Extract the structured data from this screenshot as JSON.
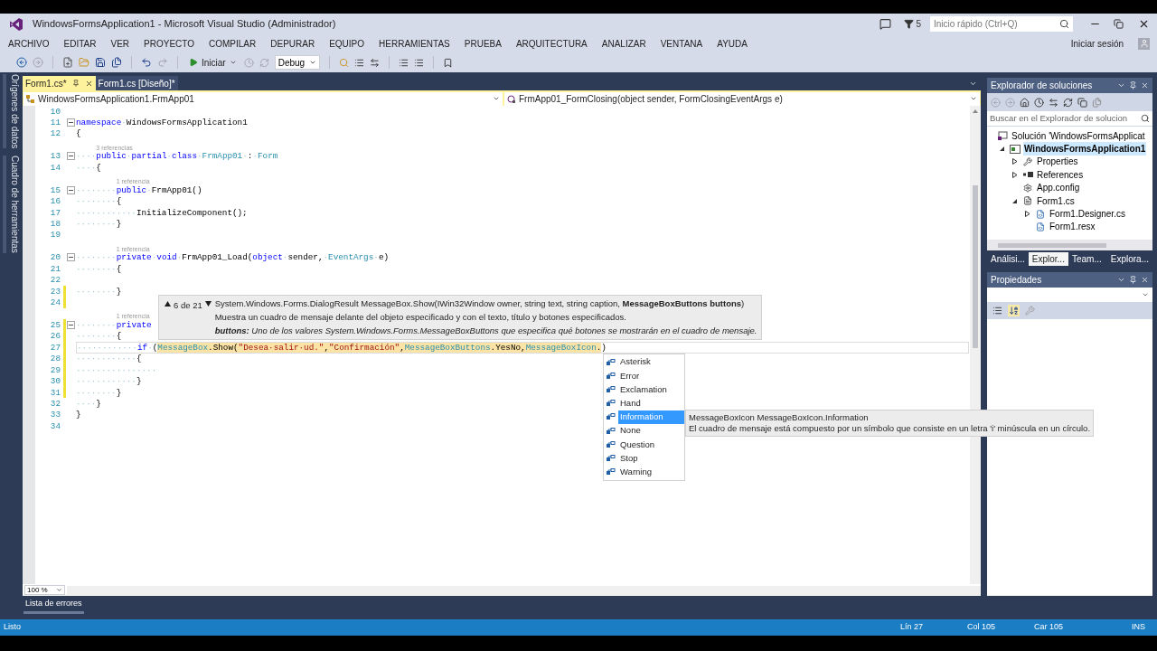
{
  "window": {
    "title": "WindowsFormsApplication1 - Microsoft Visual Studio (Administrador)",
    "notifications": "5",
    "quick_launch": {
      "placeholder": "Inicio rápido (Ctrl+Q)"
    },
    "sign_in": "Iniciar sesión"
  },
  "menu": [
    "ARCHIVO",
    "EDITAR",
    "VER",
    "PROYECTO",
    "COMPILAR",
    "DEPURAR",
    "EQUIPO",
    "HERRAMIENTAS",
    "PRUEBA",
    "ARQUITECTURA",
    "ANALIZAR",
    "VENTANA",
    "AYUDA"
  ],
  "toolbar": {
    "start": "Iniciar",
    "configuration": "Debug"
  },
  "side_tabs": [
    "Orígenes de datos",
    "Cuadro de herramientas"
  ],
  "document_tabs": [
    {
      "label": "Form1.cs*",
      "selected": true
    },
    {
      "label": "Form1.cs [Diseño]*",
      "selected": false
    }
  ],
  "navigation": {
    "type": "WindowsFormsApplication1.FrmApp01",
    "member": "FrmApp01_FormClosing(object sender, FormClosingEventArgs e)"
  },
  "editor": {
    "zoom": "100 %",
    "lines": [
      {
        "kind": "code",
        "number": "10",
        "fold": false,
        "changed": false,
        "current": false
      },
      {
        "kind": "code",
        "number": "11",
        "fold": true,
        "changed": false,
        "current": false,
        "tokens": [
          {
            "kind": "keyword",
            "text": "namespace"
          },
          {
            "kind": "space",
            "text": "·"
          },
          {
            "kind": "plain",
            "text": "WindowsFormsApplication1"
          }
        ]
      },
      {
        "kind": "code",
        "number": "12",
        "fold": false,
        "changed": false,
        "current": false,
        "tokens": [
          {
            "kind": "plain",
            "text": "{"
          }
        ]
      },
      {
        "kind": "codelens",
        "text": "3 referencias"
      },
      {
        "kind": "code",
        "number": "13",
        "fold": true,
        "changed": false,
        "current": false,
        "tokens": [
          {
            "kind": "space",
            "text": "····"
          },
          {
            "kind": "keyword",
            "text": "public"
          },
          {
            "kind": "space",
            "text": "·"
          },
          {
            "kind": "keyword",
            "text": "partial"
          },
          {
            "kind": "space",
            "text": "·"
          },
          {
            "kind": "keyword",
            "text": "class"
          },
          {
            "kind": "space",
            "text": "·"
          },
          {
            "kind": "type",
            "text": "FrmApp01"
          },
          {
            "kind": "space",
            "text": "·"
          },
          {
            "kind": "plain",
            "text": ":"
          },
          {
            "kind": "space",
            "text": "·"
          },
          {
            "kind": "type",
            "text": "Form"
          }
        ]
      },
      {
        "kind": "code",
        "number": "14",
        "fold": false,
        "changed": false,
        "current": false,
        "tokens": [
          {
            "kind": "space",
            "text": "····"
          },
          {
            "kind": "plain",
            "text": "{"
          }
        ]
      },
      {
        "kind": "codelens",
        "text": "1 referencia"
      },
      {
        "kind": "code",
        "number": "15",
        "fold": true,
        "changed": false,
        "current": false,
        "tokens": [
          {
            "kind": "space",
            "text": "········"
          },
          {
            "kind": "keyword",
            "text": "public"
          },
          {
            "kind": "space",
            "text": "·"
          },
          {
            "kind": "plain",
            "text": "FrmApp01()"
          }
        ]
      },
      {
        "kind": "code",
        "number": "16",
        "fold": false,
        "changed": false,
        "current": false,
        "tokens": [
          {
            "kind": "space",
            "text": "········"
          },
          {
            "kind": "plain",
            "text": "{"
          }
        ]
      },
      {
        "kind": "code",
        "number": "17",
        "fold": false,
        "changed": false,
        "current": false,
        "tokens": [
          {
            "kind": "space",
            "text": "············"
          },
          {
            "kind": "plain",
            "text": "InitializeComponent();"
          }
        ]
      },
      {
        "kind": "code",
        "number": "18",
        "fold": false,
        "changed": false,
        "current": false,
        "tokens": [
          {
            "kind": "space",
            "text": "········"
          },
          {
            "kind": "plain",
            "text": "}"
          }
        ]
      },
      {
        "kind": "code",
        "number": "19",
        "fold": false,
        "changed": false,
        "current": false
      },
      {
        "kind": "codelens",
        "text": "1 referencia"
      },
      {
        "kind": "code",
        "number": "20",
        "fold": true,
        "changed": false,
        "current": false,
        "tokens": [
          {
            "kind": "space",
            "text": "········"
          },
          {
            "kind": "keyword",
            "text": "private"
          },
          {
            "kind": "space",
            "text": "·"
          },
          {
            "kind": "keyword",
            "text": "void"
          },
          {
            "kind": "space",
            "text": "·"
          },
          {
            "kind": "plain",
            "text": "FrmApp01_Load("
          },
          {
            "kind": "keyword",
            "text": "object"
          },
          {
            "kind": "space",
            "text": "·"
          },
          {
            "kind": "plain",
            "text": "sender,"
          },
          {
            "kind": "space",
            "text": "·"
          },
          {
            "kind": "type",
            "text": "EventArgs"
          },
          {
            "kind": "space",
            "text": "·"
          },
          {
            "kind": "plain",
            "text": "e)"
          }
        ]
      },
      {
        "kind": "code",
        "number": "21",
        "fold": false,
        "changed": false,
        "current": false,
        "tokens": [
          {
            "kind": "space",
            "text": "········"
          },
          {
            "kind": "plain",
            "text": "{"
          }
        ]
      },
      {
        "kind": "code",
        "number": "22",
        "fold": false,
        "changed": false,
        "current": false
      },
      {
        "kind": "code",
        "number": "23",
        "fold": false,
        "changed": true,
        "current": false,
        "tokens": [
          {
            "kind": "space",
            "text": "········"
          },
          {
            "kind": "plain",
            "text": "}"
          }
        ]
      },
      {
        "kind": "code",
        "number": "24",
        "fold": false,
        "changed": true,
        "current": false
      },
      {
        "kind": "codelens",
        "text": "1 referencia"
      },
      {
        "kind": "code",
        "number": "25",
        "fold": true,
        "changed": true,
        "current": false,
        "tokens": [
          {
            "kind": "space",
            "text": "········"
          },
          {
            "kind": "keyword",
            "text": "private"
          }
        ]
      },
      {
        "kind": "code",
        "number": "26",
        "fold": false,
        "changed": true,
        "current": false,
        "tokens": [
          {
            "kind": "space",
            "text": "········"
          },
          {
            "kind": "plain",
            "text": "{"
          }
        ]
      },
      {
        "kind": "code",
        "number": "27",
        "fold": false,
        "changed": true,
        "current": true,
        "tokens": [
          {
            "kind": "space",
            "text": "············",
            "highlighted": false
          },
          {
            "kind": "keyword",
            "text": "if",
            "highlighted": false
          },
          {
            "kind": "space",
            "text": "·",
            "highlighted": false
          },
          {
            "kind": "plain",
            "text": "(",
            "highlighted": false
          },
          {
            "kind": "type",
            "text": "MessageBox",
            "highlighted": true
          },
          {
            "kind": "plain",
            "text": ".Show(",
            "highlighted": true
          },
          {
            "kind": "string",
            "text": "\"Desea·salir·ud.\"",
            "highlighted": true
          },
          {
            "kind": "plain",
            "text": ",",
            "highlighted": true
          },
          {
            "kind": "string",
            "text": "\"Confirmación\"",
            "highlighted": true
          },
          {
            "kind": "plain",
            "text": ",",
            "highlighted": true
          },
          {
            "kind": "type",
            "text": "MessageBoxButtons",
            "highlighted": true
          },
          {
            "kind": "plain",
            "text": ".YesNo,",
            "highlighted": true
          },
          {
            "kind": "type",
            "text": "MessageBoxIcon",
            "highlighted": true
          },
          {
            "kind": "plain",
            "text": ".",
            "highlighted": true
          },
          {
            "kind": "plain",
            "text": ")",
            "highlighted": false
          }
        ]
      },
      {
        "kind": "code",
        "number": "28",
        "fold": false,
        "changed": true,
        "current": false,
        "tokens": [
          {
            "kind": "space",
            "text": "············"
          },
          {
            "kind": "plain",
            "text": "{"
          }
        ]
      },
      {
        "kind": "code",
        "number": "29",
        "fold": false,
        "changed": true,
        "current": false,
        "tokens": [
          {
            "kind": "space",
            "text": "················"
          }
        ]
      },
      {
        "kind": "code",
        "number": "30",
        "fold": false,
        "changed": true,
        "current": false,
        "tokens": [
          {
            "kind": "space",
            "text": "············"
          },
          {
            "kind": "plain",
            "text": "}"
          }
        ]
      },
      {
        "kind": "code",
        "number": "31",
        "fold": false,
        "changed": true,
        "current": false,
        "tokens": [
          {
            "kind": "space",
            "text": "········"
          },
          {
            "kind": "plain",
            "text": "}"
          }
        ]
      },
      {
        "kind": "code",
        "number": "32",
        "fold": false,
        "changed": false,
        "current": false,
        "tokens": [
          {
            "kind": "space",
            "text": "····"
          },
          {
            "kind": "plain",
            "text": "}"
          }
        ]
      },
      {
        "kind": "code",
        "number": "33",
        "fold": false,
        "changed": false,
        "current": false,
        "tokens": [
          {
            "kind": "plain",
            "text": "}"
          }
        ]
      },
      {
        "kind": "code",
        "number": "34",
        "fold": false,
        "changed": false,
        "current": false
      }
    ]
  },
  "parameter_info": {
    "counter": "6 de 21",
    "signature": "System.Windows.Forms.DialogResult MessageBox.Show(IWin32Window owner, string text, string caption, **MessageBoxButtons buttons**)",
    "description": "Muestra un cuadro de mensaje delante del objeto especificado y con el texto, título y botones especificados.",
    "parameter": "**buttons:** Uno de los valores System.Windows.Forms.MessageBoxButtons que especifica qué botones se mostrarán en el cuadro de mensaje."
  },
  "completion": {
    "items": [
      {
        "label": "Asterisk",
        "selected": false
      },
      {
        "label": "Error",
        "selected": false
      },
      {
        "label": "Exclamation",
        "selected": false
      },
      {
        "label": "Hand",
        "selected": false
      },
      {
        "label": "Information",
        "selected": true
      },
      {
        "label": "None",
        "selected": false
      },
      {
        "label": "Question",
        "selected": false
      },
      {
        "label": "Stop",
        "selected": false
      },
      {
        "label": "Warning",
        "selected": false
      }
    ],
    "description": {
      "title": "MessageBoxIcon MessageBoxIcon.Information",
      "text": "El cuadro de mensaje está compuesto por un símbolo que consiste en un letra 'i' minúscula en un círculo."
    }
  },
  "solution_explorer": {
    "title": "Explorador de soluciones",
    "search": {
      "placeholder": "Buscar en el Explorador de solucion"
    },
    "tree": [
      {
        "label": "Solución 'WindowsFormsApplicat",
        "kind": "solution",
        "selected": false,
        "startup": false,
        "children": [
          {
            "label": "WindowsFormsApplication1",
            "kind": "project",
            "selected": true,
            "startup": true,
            "expanded": true,
            "children": [
              {
                "label": "Properties",
                "kind": "properties",
                "selected": false,
                "startup": false,
                "expanded": false
              },
              {
                "label": "References",
                "kind": "references",
                "selected": false,
                "startup": false,
                "expanded": false
              },
              {
                "label": "App.config",
                "kind": "config",
                "selected": false,
                "startup": false
              },
              {
                "label": "Form1.cs",
                "kind": "form",
                "selected": false,
                "startup": false,
                "expanded": true,
                "children": [
                  {
                    "label": "Form1.Designer.cs",
                    "kind": "file",
                    "selected": false,
                    "startup": false,
                    "expanded": false
                  },
                  {
                    "label": "Form1.resx",
                    "kind": "file",
                    "selected": false,
                    "startup": false
                  }
                ]
              }
            ]
          }
        ]
      }
    ],
    "tabs": [
      {
        "label": "Análisi...",
        "selected": false
      },
      {
        "label": "Explor...",
        "selected": true
      },
      {
        "label": "Team...",
        "selected": false
      },
      {
        "label": "Explora...",
        "selected": false
      }
    ]
  },
  "properties": {
    "title": "Propiedades"
  },
  "bottom_tabs": [
    {
      "label": "Lista de errores",
      "selected": true
    }
  ],
  "status_bar": {
    "message": "Listo",
    "line": "Lín 27",
    "column": "Col 105",
    "character": "Car 105",
    "mode": "INS"
  }
}
